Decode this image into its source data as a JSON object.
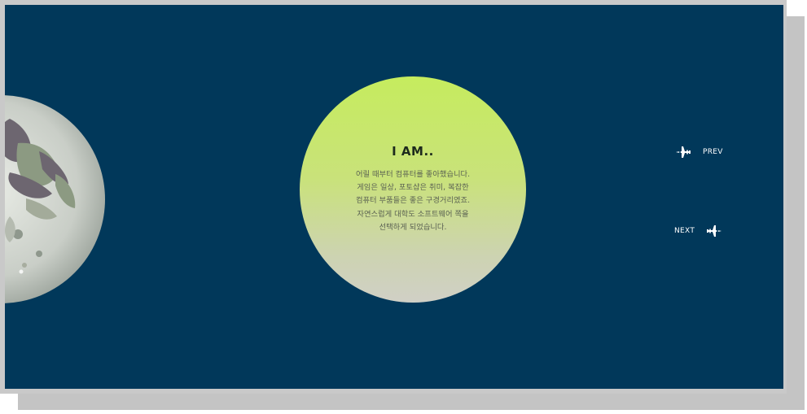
{
  "intro": {
    "title": "I AM..",
    "lines": [
      "어릴 때부터 컴퓨터를 좋아했습니다.",
      "게임은 일상, 포토샵은 취미, 복잡한",
      "컴퓨터 부품들은 좋은 구경거리였죠.",
      "자연스럽게 대학도 소프트웨어 쪽을",
      "선택하게 되었습니다."
    ]
  },
  "nav": {
    "prev_label": "PREV",
    "next_label": "NEXT",
    "prev_icon": "rocket-left-icon",
    "next_icon": "rocket-right-icon"
  },
  "colors": {
    "background": "#01385a",
    "bubble_top": "#c6ec5e",
    "bubble_bottom": "#d0d0c6"
  },
  "decor": {
    "moon": "moon-icon"
  }
}
